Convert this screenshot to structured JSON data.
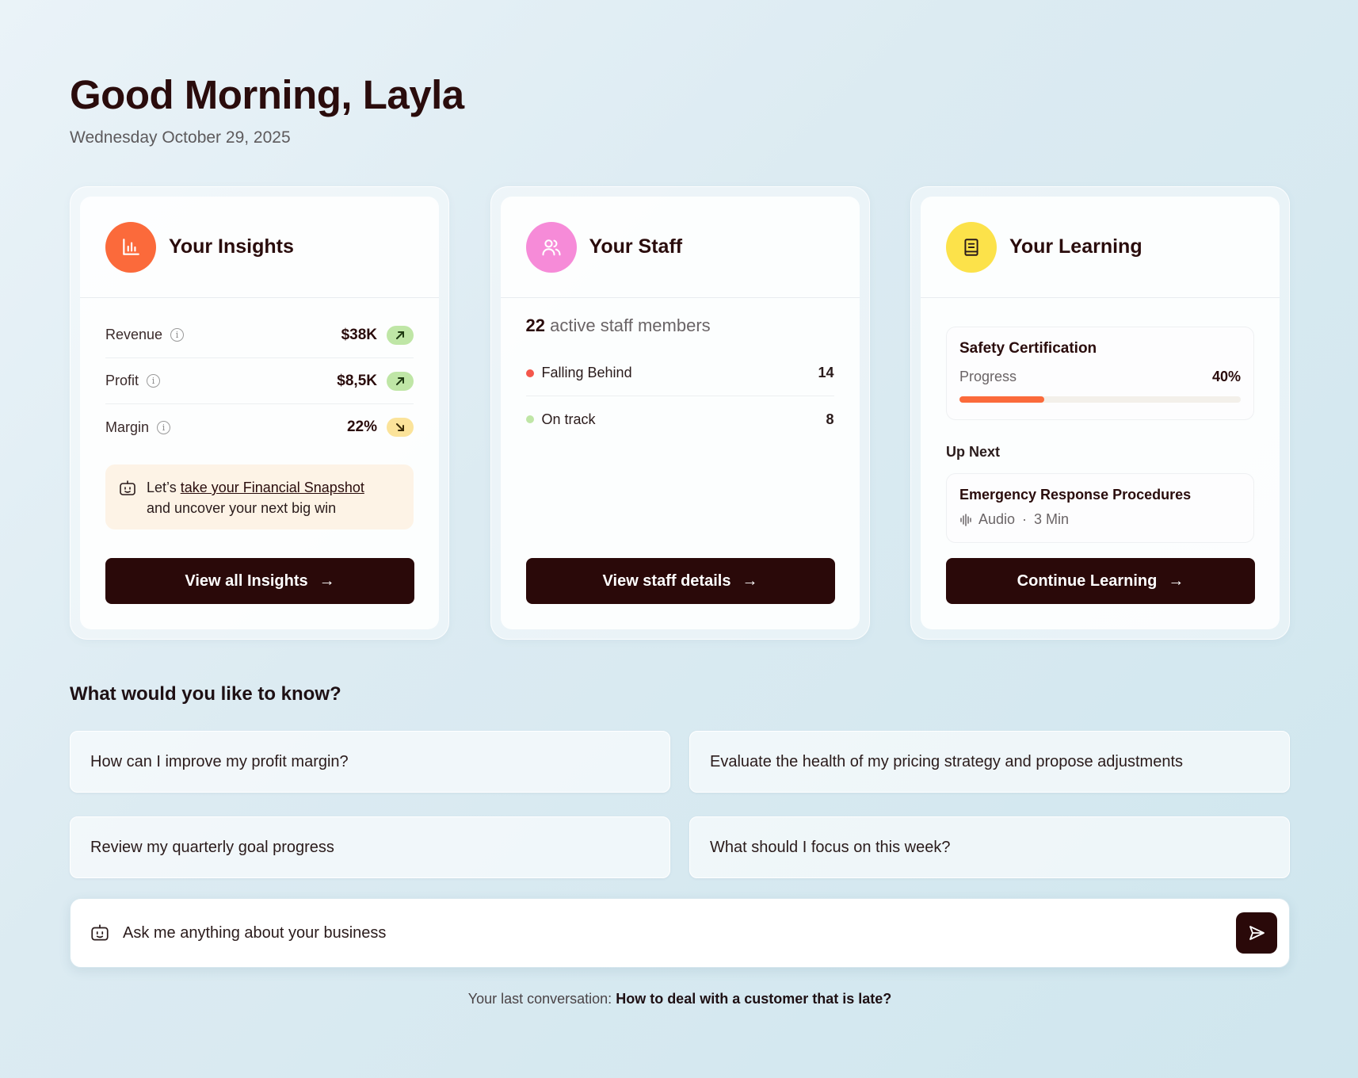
{
  "header": {
    "greeting": "Good Morning, Layla",
    "date": "Wednesday October 29, 2025"
  },
  "insights": {
    "title": "Your Insights",
    "icon": "bar-chart-icon",
    "icon_color": "#FB6A3B",
    "metrics": [
      {
        "label": "Revenue",
        "value": "$38K",
        "trend": "up"
      },
      {
        "label": "Profit",
        "value": "$8,5K",
        "trend": "up"
      },
      {
        "label": "Margin",
        "value": "22%",
        "trend": "down"
      }
    ],
    "snapshot": {
      "prefix": "Let’s ",
      "link": "take your Financial Snapshot",
      "suffix": "and uncover your next big win"
    },
    "cta": "View all Insights"
  },
  "staff": {
    "title": "Your Staff",
    "icon": "users-icon",
    "icon_color": "#F68BD8",
    "count": "22",
    "count_label": "active staff members",
    "rows": [
      {
        "label": "Falling Behind",
        "value": "14",
        "color": "#F4574B"
      },
      {
        "label": "On track",
        "value": "8",
        "color": "#BFE6A6"
      }
    ],
    "cta": "View staff details"
  },
  "learning": {
    "title": "Your Learning",
    "icon": "book-icon",
    "icon_color": "#FCE24A",
    "course": {
      "title": "Safety Certification",
      "progress_label": "Progress",
      "progress_text": "40%",
      "progress": 0.3
    },
    "up_next_label": "Up Next",
    "next": {
      "title": "Emergency Response Procedures",
      "type": "Audio",
      "duration": "3 Min"
    },
    "cta": "Continue Learning"
  },
  "ask": {
    "title": "What would you like to know?",
    "suggestions": [
      "How can I improve my profit margin?",
      "Evaluate the health of my pricing strategy and propose adjustments",
      "Review my quarterly goal progress",
      "What should I focus on this week?"
    ]
  },
  "chat": {
    "placeholder": "Ask me anything about your business"
  },
  "last_conversation": {
    "label": "Your last conversation:",
    "topic": "How to deal with a customer that is late?"
  }
}
